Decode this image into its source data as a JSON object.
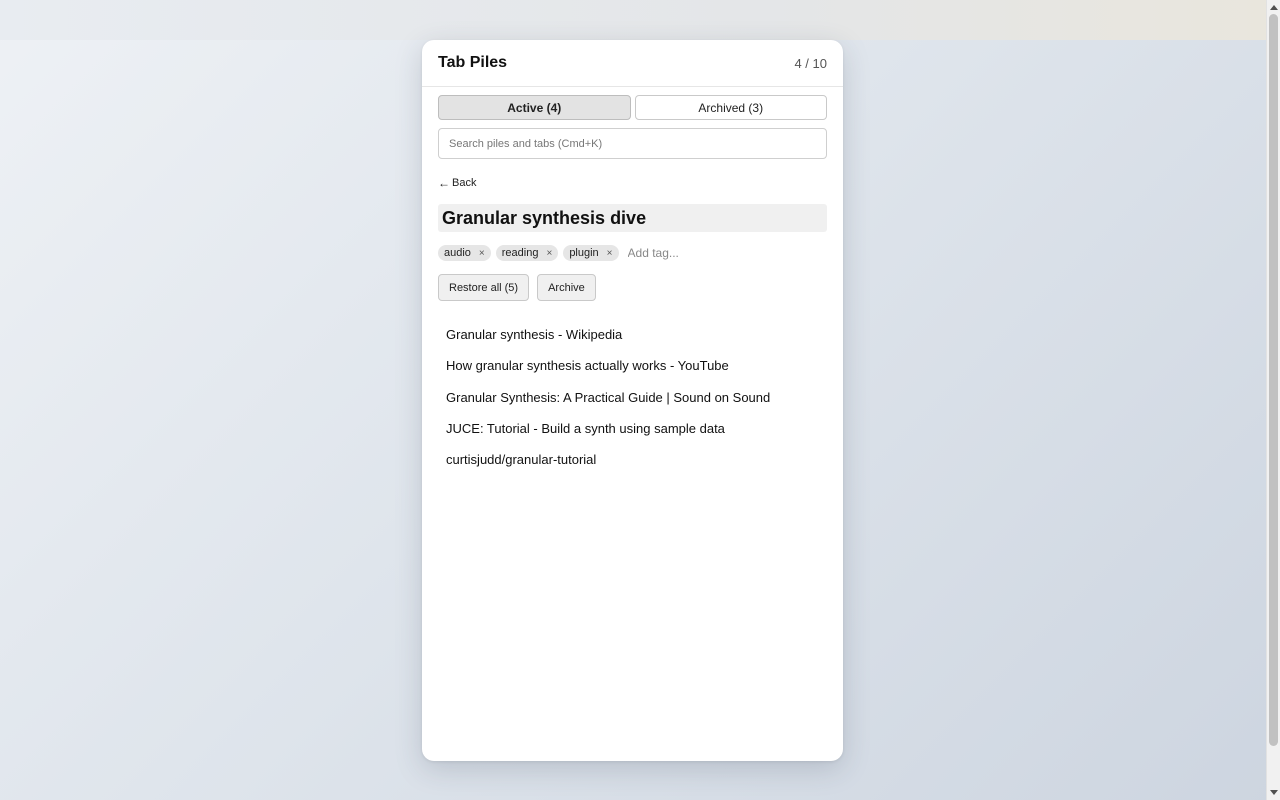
{
  "app": {
    "title": "Tab Piles",
    "count": "4 / 10"
  },
  "tabs": {
    "active_label": "Active (4)",
    "archived_label": "Archived (3)"
  },
  "search": {
    "placeholder": "Search piles and tabs (Cmd+K)",
    "value": ""
  },
  "nav": {
    "back_arrow": "←",
    "back_label": "Back"
  },
  "pile": {
    "title": "Granular synthesis dive",
    "tags": [
      "audio",
      "reading",
      "plugin"
    ],
    "tag_remove_glyph": "×",
    "add_tag_placeholder": "Add tag...",
    "restore_label": "Restore all (5)",
    "archive_label": "Archive",
    "items": [
      "Granular synthesis - Wikipedia",
      "How granular synthesis actually works - YouTube",
      "Granular Synthesis: A Practical Guide | Sound on Sound",
      "JUCE: Tutorial - Build a synth using sample data",
      "curtisjudd/granular-tutorial"
    ]
  },
  "icons": {
    "back": "back-arrow-icon",
    "tag_remove": "close-icon"
  }
}
